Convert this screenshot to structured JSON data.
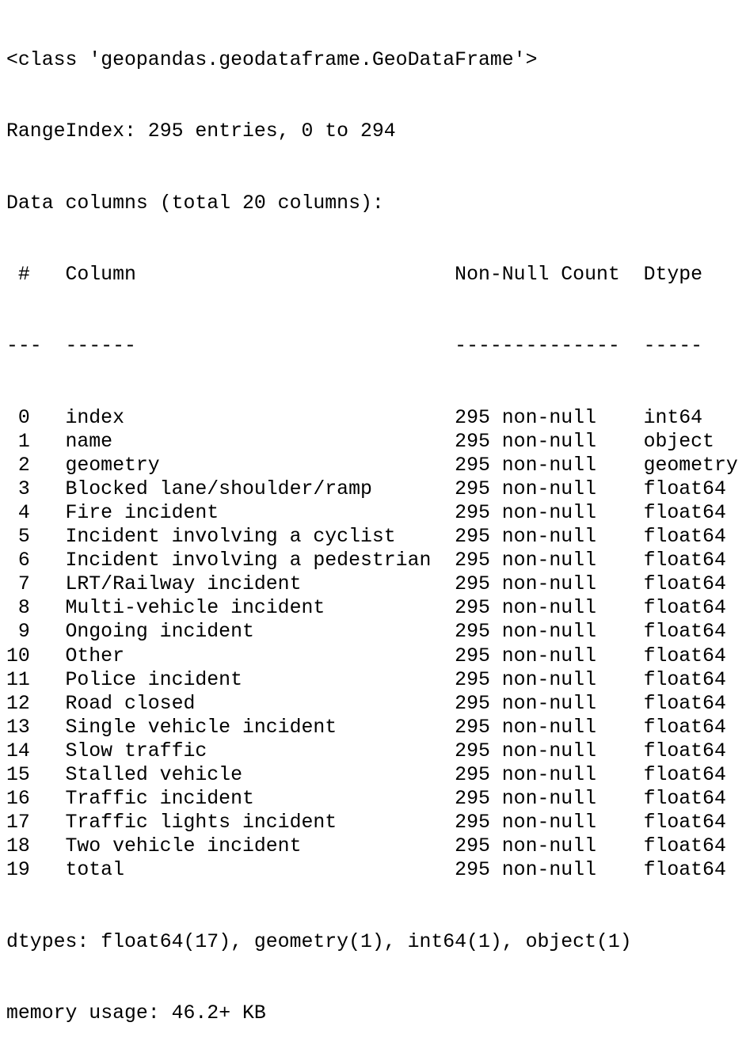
{
  "header": {
    "class_line": "<class 'geopandas.geodataframe.GeoDataFrame'>",
    "range_index": "RangeIndex: 295 entries, 0 to 294",
    "data_columns": "Data columns (total 20 columns):"
  },
  "table": {
    "headers": {
      "index": "#",
      "column": "Column",
      "count": "Non-Null Count",
      "dtype": "Dtype"
    },
    "separators": {
      "index": "---",
      "column": "------",
      "count": "--------------",
      "dtype": "-----"
    },
    "rows": [
      {
        "i": "0",
        "name": "index",
        "count": "295 non-null",
        "dtype": "int64"
      },
      {
        "i": "1",
        "name": "name",
        "count": "295 non-null",
        "dtype": "object"
      },
      {
        "i": "2",
        "name": "geometry",
        "count": "295 non-null",
        "dtype": "geometry"
      },
      {
        "i": "3",
        "name": "Blocked lane/shoulder/ramp",
        "count": "295 non-null",
        "dtype": "float64"
      },
      {
        "i": "4",
        "name": "Fire incident",
        "count": "295 non-null",
        "dtype": "float64"
      },
      {
        "i": "5",
        "name": "Incident involving a cyclist",
        "count": "295 non-null",
        "dtype": "float64"
      },
      {
        "i": "6",
        "name": "Incident involving a pedestrian",
        "count": "295 non-null",
        "dtype": "float64"
      },
      {
        "i": "7",
        "name": "LRT/Railway incident",
        "count": "295 non-null",
        "dtype": "float64"
      },
      {
        "i": "8",
        "name": "Multi-vehicle incident",
        "count": "295 non-null",
        "dtype": "float64"
      },
      {
        "i": "9",
        "name": "Ongoing incident",
        "count": "295 non-null",
        "dtype": "float64"
      },
      {
        "i": "10",
        "name": "Other",
        "count": "295 non-null",
        "dtype": "float64"
      },
      {
        "i": "11",
        "name": "Police incident",
        "count": "295 non-null",
        "dtype": "float64"
      },
      {
        "i": "12",
        "name": "Road closed",
        "count": "295 non-null",
        "dtype": "float64"
      },
      {
        "i": "13",
        "name": "Single vehicle incident",
        "count": "295 non-null",
        "dtype": "float64"
      },
      {
        "i": "14",
        "name": "Slow traffic",
        "count": "295 non-null",
        "dtype": "float64"
      },
      {
        "i": "15",
        "name": "Stalled vehicle",
        "count": "295 non-null",
        "dtype": "float64"
      },
      {
        "i": "16",
        "name": "Traffic incident",
        "count": "295 non-null",
        "dtype": "float64"
      },
      {
        "i": "17",
        "name": "Traffic lights incident",
        "count": "295 non-null",
        "dtype": "float64"
      },
      {
        "i": "18",
        "name": "Two vehicle incident",
        "count": "295 non-null",
        "dtype": "float64"
      },
      {
        "i": "19",
        "name": "total",
        "count": "295 non-null",
        "dtype": "float64"
      }
    ]
  },
  "footer": {
    "dtypes": "dtypes: float64(17), geometry(1), int64(1), object(1)",
    "memory": "memory usage: 46.2+ KB"
  }
}
